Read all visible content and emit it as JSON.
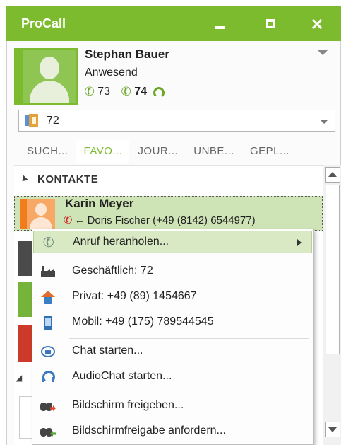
{
  "window": {
    "title": "ProCall",
    "accent_color": "#7dbb2e"
  },
  "profile": {
    "name": "Stephan Bauer",
    "status": "Anwesend",
    "line1": "73",
    "line2": "74",
    "menu_icon": "chevron-down-icon"
  },
  "line_selector": {
    "value": "72"
  },
  "tabs": [
    {
      "label": "SUCH..."
    },
    {
      "label": "FAVO...",
      "active": true
    },
    {
      "label": "JOUR..."
    },
    {
      "label": "UNBE..."
    },
    {
      "label": "GEPL..."
    }
  ],
  "section": {
    "title": "KONTAKTE"
  },
  "contact": {
    "name": "Karin Meyer",
    "detail": "Doris Fischer (+49 (8142) 6544977)",
    "call_direction": "←"
  },
  "context_menu": {
    "items": [
      {
        "label": "Anruf heranholen...",
        "icon": "call-pickup-icon",
        "has_submenu": true
      },
      {
        "label": "Geschäftlich: 72",
        "icon": "business-phone-icon"
      },
      {
        "label": "Privat: +49 (89) 1454667",
        "icon": "home-icon"
      },
      {
        "label": "Mobil: +49 (175) 789544545",
        "icon": "mobile-phone-icon"
      },
      {
        "label": "Chat starten...",
        "icon": "chat-icon"
      },
      {
        "label": "AudioChat starten...",
        "icon": "headset-icon"
      },
      {
        "label": "Bildschirm freigeben...",
        "icon": "share-screen-icon"
      },
      {
        "label": "Bildschirmfreigabe anfordern...",
        "icon": "request-screen-share-icon"
      }
    ]
  }
}
